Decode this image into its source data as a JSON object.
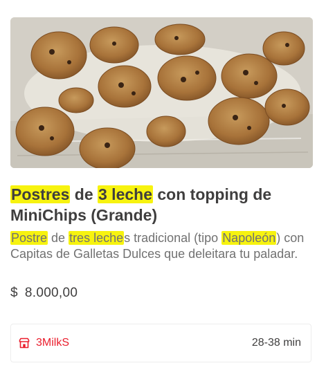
{
  "product": {
    "title_parts": [
      "Postres",
      " de ",
      "3 leche",
      " con topping de MiniChips (Grande)"
    ],
    "description_parts": [
      "Postre",
      " de ",
      "tres leche",
      "s tradicional (tipo ",
      "Napoleón",
      ") con Capitas de Galletas Dulces que deleitara tu paladar."
    ],
    "price_currency": "$",
    "price_value": "8.000,00",
    "image_icon": "cookies-dessert-photo"
  },
  "store": {
    "name": "3MilkS",
    "icon": "store-icon",
    "delivery_time": "28-38 min"
  },
  "colors": {
    "highlight": "#f7f30f",
    "brand": "#ea1d2c",
    "title": "#3f3e3e",
    "description": "#717171"
  }
}
